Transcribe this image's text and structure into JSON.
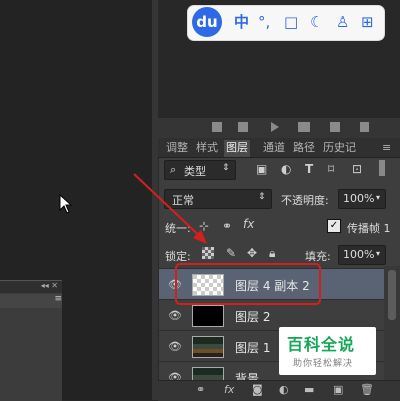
{
  "ime_toolbar": {
    "logo": "du",
    "items": [
      "中",
      "°,",
      "□",
      "☾",
      "♙",
      "⊞"
    ],
    "icons": [
      "chinese-mode-icon",
      "punctuation-icon",
      "skin-icon",
      "moon-icon",
      "user-icon",
      "grid-menu-icon"
    ],
    "color": "#2f6ae6"
  },
  "minipanel": {
    "header_icons": "◂◂ ✕",
    "menu_icon": "≡"
  },
  "panel": {
    "tabs": [
      "调整",
      "样式",
      "图层",
      "通道",
      "路径",
      "历史记",
      "≡"
    ],
    "active_tab": "图层",
    "filter": {
      "icon": "⌕",
      "value": "类型",
      "caret": "⇕"
    },
    "blend_mode": {
      "value": "正常",
      "caret": "⇕"
    },
    "opacity": {
      "label": "不透明度:",
      "value": "100%"
    },
    "unify": {
      "label": "统一:"
    },
    "propagate": {
      "label": "传播帧 1",
      "checked": true
    },
    "lock": {
      "label": "锁定:"
    },
    "fill": {
      "label": "填充:",
      "value": "100%"
    },
    "layers": [
      {
        "name": "图层 4 副本 2",
        "visible": true,
        "selected": true,
        "thumb": "transparent"
      },
      {
        "name": "图层 2",
        "visible": true,
        "selected": false,
        "thumb": "black"
      },
      {
        "name": "图层 1",
        "visible": true,
        "selected": false,
        "thumb": "room"
      },
      {
        "name": "背景",
        "visible": true,
        "selected": false,
        "thumb": "room"
      }
    ],
    "bottom_icons": [
      "link-icon",
      "fx-icon",
      "mask-icon",
      "adjustment-icon",
      "group-icon",
      "new-layer-icon",
      "trash-icon"
    ],
    "highlight_color": "#d22020"
  },
  "watermark": {
    "title": "百科全说",
    "subtitle": "助你轻松解决"
  }
}
